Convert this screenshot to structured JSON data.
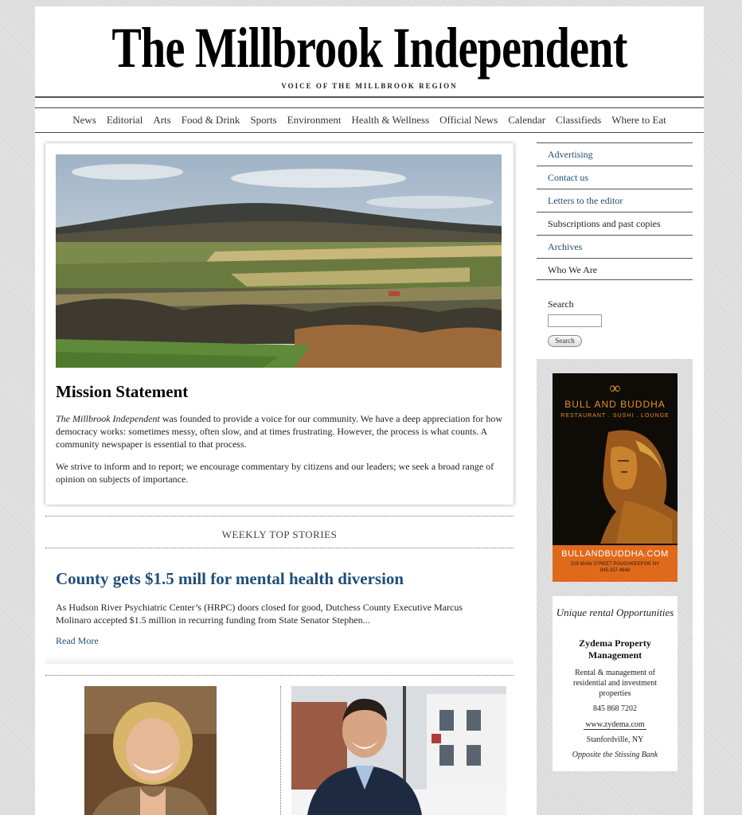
{
  "masthead": {
    "title": "The Millbrook Independent",
    "tagline": "VOICE OF THE MILLBROOK REGION"
  },
  "nav": [
    "News",
    "Editorial",
    "Arts",
    "Food & Drink",
    "Sports",
    "Environment",
    "Health & Wellness",
    "Official News",
    "Calendar",
    "Classifieds",
    "Where to Eat"
  ],
  "mission": {
    "title": "Mission Statement",
    "p1_italic": "The Millbrook Independent",
    "p1_rest": " was founded to provide a voice for our community. We have a deep appreciation for how democracy works: sometimes messy, often slow, and at times frustrating. However, the process is what counts. A community newspaper is essential to that process.",
    "p2": "We strive to inform and to report; we encourage commentary by citizens and our leaders; we seek a broad range of opinion on subjects of importance."
  },
  "weekly": {
    "label": "WEEKLY TOP STORIES"
  },
  "story": {
    "title": "County gets $1.5 mill for mental health diversion",
    "excerpt": "As Hudson River Psychiatric Center’s (HRPC) doors closed for good, Dutchess County Executive Marcus Molinaro accepted $1.5 million in recurring funding from State Senator Stephen...",
    "read_more": "Read More"
  },
  "sidebar": {
    "links": [
      {
        "label": "Advertising",
        "style": "blue"
      },
      {
        "label": "Contact us",
        "style": "blue"
      },
      {
        "label": "Letters to the editor",
        "style": "blue"
      },
      {
        "label": "Subscriptions and past copies",
        "style": "dark"
      },
      {
        "label": "Archives",
        "style": "blue"
      },
      {
        "label": "Who We Are",
        "style": "dark"
      }
    ],
    "search_label": "Search",
    "search_button": "Search"
  },
  "ad_bull": {
    "logo": "Ȣ",
    "name": "BULL AND BUDDHA",
    "sub": "RESTAURANT . SUSHI . LOUNGE",
    "url": "BULLANDBUDDHA.COM",
    "addr1": "319 MAIN STREET POUGHKEEPSIE NY",
    "addr2": "845-337-4848"
  },
  "ad_zydema": {
    "line1": "Unique rental Opportunities",
    "line2": "Zydema Property Management",
    "line3": "Rental & management of residential and investment properties",
    "phone": "845 868 7202",
    "url": "www.zydema.com",
    "city": "Stanfordville, NY",
    "note": "Opposite the Stissing Bank"
  },
  "colors": {
    "link_blue": "#1f4e7a",
    "ad_orange": "#e06a1c"
  }
}
